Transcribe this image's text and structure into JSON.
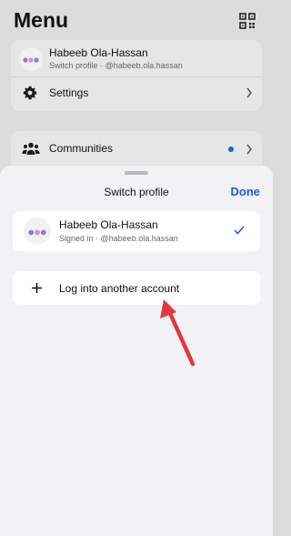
{
  "menu": {
    "title": "Menu",
    "profile": {
      "name": "Habeeb Ola-Hassan",
      "subtitle": "Switch profile · @habeeb.ola.hassan"
    },
    "settings_label": "Settings",
    "communities_label": "Communities"
  },
  "sheet": {
    "title": "Switch profile",
    "done_label": "Done",
    "account": {
      "name": "Habeeb Ola-Hassan",
      "status": "Signed in · @habeeb.ola.hassan",
      "selected": true
    },
    "add_account_label": "Log into another account"
  },
  "colors": {
    "accent": "#1b5fd9",
    "annotation_arrow": "#e0383e"
  },
  "icons": [
    "qr-code-icon",
    "gear-icon",
    "chevron-right-icon",
    "people-icon",
    "check-icon",
    "plus-icon"
  ]
}
